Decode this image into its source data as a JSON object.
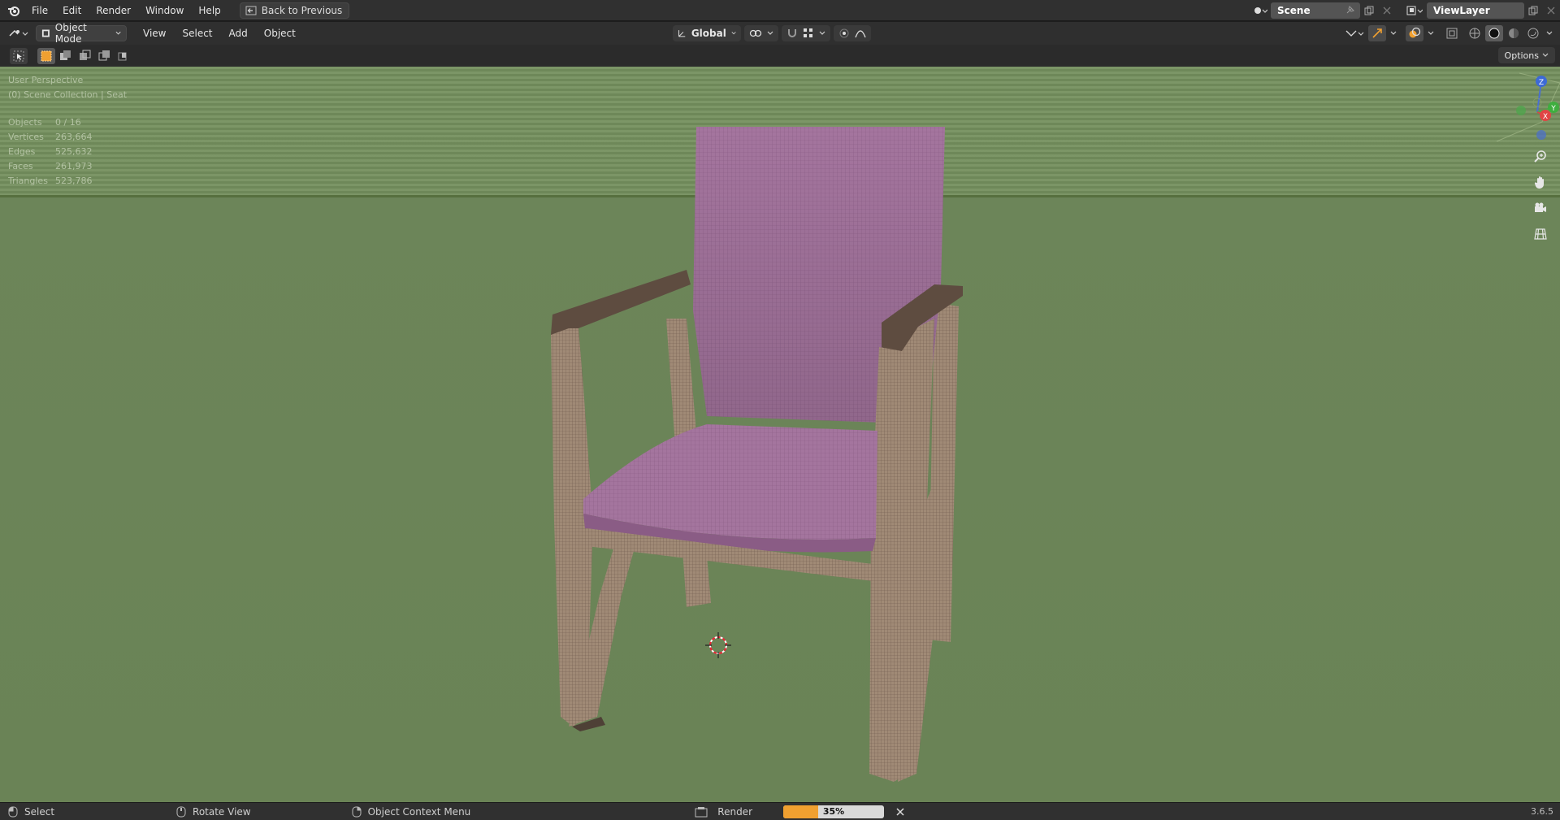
{
  "topbar": {
    "menus": [
      "File",
      "Edit",
      "Render",
      "Window",
      "Help"
    ],
    "back_label": "Back to Previous",
    "scene_name": "Scene",
    "view_layer": "ViewLayer"
  },
  "header": {
    "mode": "Object Mode",
    "menus": [
      "View",
      "Select",
      "Add",
      "Object"
    ],
    "orientation": "Global"
  },
  "subheader": {
    "options_label": "Options"
  },
  "viewport": {
    "perspective": "User Perspective",
    "collection": "(0) Scene Collection | Seat",
    "stats": [
      {
        "label": "Objects",
        "value": "0 / 16"
      },
      {
        "label": "Vertices",
        "value": "263,664"
      },
      {
        "label": "Edges",
        "value": "525,632"
      },
      {
        "label": "Faces",
        "value": "261,973"
      },
      {
        "label": "Triangles",
        "value": "523,786"
      }
    ],
    "gizmo": {
      "z": "Z",
      "y": "Y",
      "x": "X"
    },
    "colors": {
      "background": "#6c8559",
      "chair_frame": "#a38f7c",
      "seat": "#a97aa3"
    }
  },
  "statusbar": {
    "select_label": "Select",
    "rotate_label": "Rotate View",
    "context_label": "Object Context Menu",
    "render_label": "Render",
    "progress_percent": 35,
    "progress_text": "35%",
    "version": "3.6.5"
  }
}
